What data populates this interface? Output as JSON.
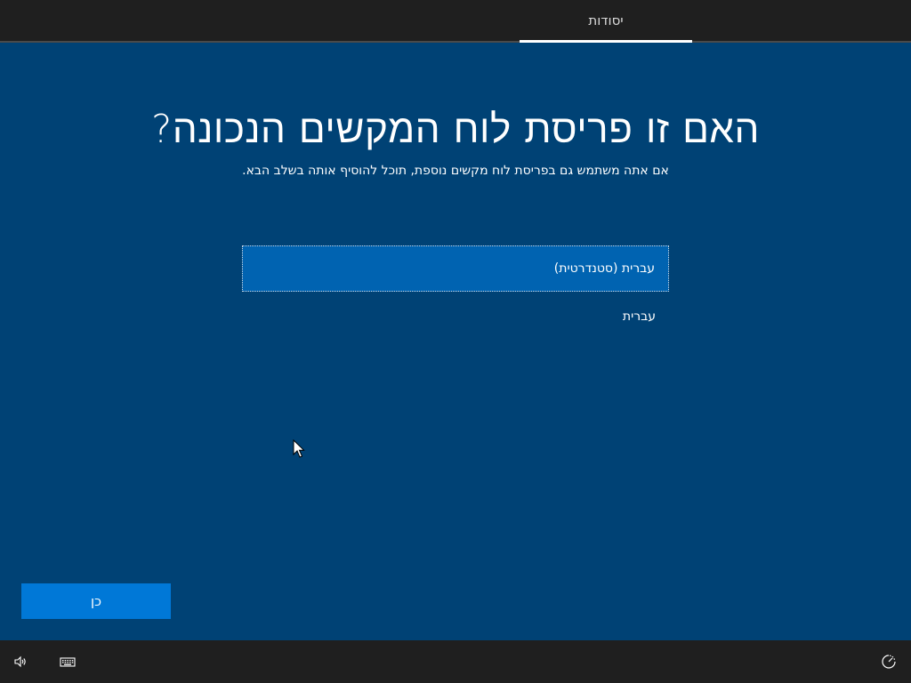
{
  "header": {
    "tab_label": "יסודות"
  },
  "main": {
    "title": "האם זו פריסת לוח המקשים הנכונה?",
    "subtitle": "אם אתה משתמש גם בפריסת לוח מקשים נוספת, תוכל להוסיף אותה בשלב הבא.",
    "options": [
      {
        "label": "עברית (סטנדרטית)",
        "selected": true
      },
      {
        "label": "עברית",
        "selected": false
      }
    ]
  },
  "footer": {
    "next_label": "כן",
    "icons": [
      "volume-icon",
      "keyboard-icon",
      "accessibility-icon"
    ]
  },
  "colors": {
    "background": "#004275",
    "selected": "#0063b1",
    "button": "#0078d7",
    "bars": "#1f1f1f"
  }
}
